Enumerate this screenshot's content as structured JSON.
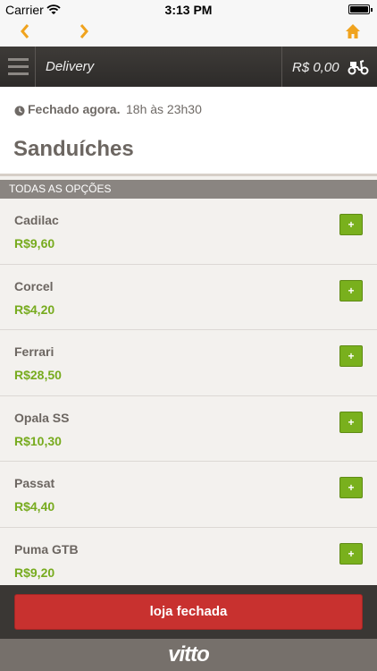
{
  "status_bar": {
    "carrier": "Carrier",
    "time": "3:13 PM"
  },
  "header": {
    "title": "Delivery",
    "cart_total": "R$ 0,00"
  },
  "store": {
    "status": "Fechado agora.",
    "hours": "18h às 23h30",
    "category": "Sanduíches"
  },
  "section": {
    "title": "TODAS AS OPÇÕES"
  },
  "products": [
    {
      "name": "Cadilac",
      "price": "R$9,60",
      "add": "+"
    },
    {
      "name": "Corcel",
      "price": "R$4,20",
      "add": "+"
    },
    {
      "name": "Ferrari",
      "price": "R$28,50",
      "add": "+"
    },
    {
      "name": "Opala SS",
      "price": "R$10,30",
      "add": "+"
    },
    {
      "name": "Passat",
      "price": "R$4,40",
      "add": "+"
    },
    {
      "name": "Puma GTB",
      "price": "R$9,20",
      "add": "+"
    }
  ],
  "footer": {
    "closed_label": "loja fechada"
  },
  "brand": {
    "logo_text": "vitto"
  },
  "colors": {
    "accent_orange": "#f0a31e",
    "price_green": "#77ab1e",
    "closed_red": "#c8312f"
  }
}
